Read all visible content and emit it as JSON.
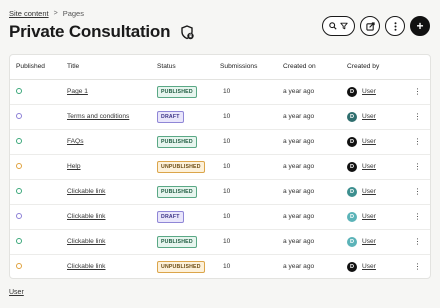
{
  "breadcrumb": {
    "parent": "Site content",
    "separator": ">",
    "current": "Pages"
  },
  "page": {
    "title": "Private Consultation",
    "title_icon": "shield-lock-icon"
  },
  "toolbar": {
    "search_icon": "search-icon",
    "filter_icon": "filter-icon",
    "edit_icon": "edit-external-icon",
    "more_icon": "more-vertical-icon",
    "add_label": "+"
  },
  "table": {
    "headers": {
      "published": "Published",
      "title": "Title",
      "status": "Status",
      "submissions": "Submissions",
      "created_on": "Created on",
      "created_by": "Created by"
    },
    "rows": [
      {
        "published_color": "#3aa77a",
        "title": "Page 1",
        "status": "PUBLISHED",
        "status_kind": "published",
        "submissions": "10",
        "created_on": "a year ago",
        "avatar": "D",
        "avatar_color": "#111111",
        "user": "User",
        "menu": "⋮"
      },
      {
        "published_color": "#8c7fd6",
        "title": "Terms and conditions",
        "status": "DRAFT",
        "status_kind": "draft",
        "submissions": "10",
        "created_on": "a year ago",
        "avatar": "D",
        "avatar_color": "#2f6e6e",
        "user": "User",
        "menu": "⋮"
      },
      {
        "published_color": "#3aa77a",
        "title": "FAQs",
        "status": "PUBLISHED",
        "status_kind": "published",
        "submissions": "10",
        "created_on": "a year ago",
        "avatar": "D",
        "avatar_color": "#111111",
        "user": "User",
        "menu": "⋮"
      },
      {
        "published_color": "#e0a23e",
        "title": "Help",
        "status": "UNPUBLISHED",
        "status_kind": "unpublished",
        "submissions": "10",
        "created_on": "a year ago",
        "avatar": "D",
        "avatar_color": "#111111",
        "user": "User",
        "menu": "⋮"
      },
      {
        "published_color": "#3aa77a",
        "title": "Clickable link",
        "status": "PUBLISHED",
        "status_kind": "published",
        "submissions": "10",
        "created_on": "a year ago",
        "avatar": "D",
        "avatar_color": "#3d8f8f",
        "user": "User",
        "menu": "⋮"
      },
      {
        "published_color": "#8c7fd6",
        "title": "Clickable link",
        "status": "DRAFT",
        "status_kind": "draft",
        "submissions": "10",
        "created_on": "a year ago",
        "avatar": "D",
        "avatar_color": "#5bb3b8",
        "user": "User",
        "menu": "⋮"
      },
      {
        "published_color": "#3aa77a",
        "title": "Clickable link",
        "status": "PUBLISHED",
        "status_kind": "published",
        "submissions": "10",
        "created_on": "a year ago",
        "avatar": "D",
        "avatar_color": "#5bb3b8",
        "user": "User",
        "menu": "⋮"
      },
      {
        "published_color": "#e0a23e",
        "title": "Clickable link",
        "status": "UNPUBLISHED",
        "status_kind": "unpublished",
        "submissions": "10",
        "created_on": "a year ago",
        "avatar": "D",
        "avatar_color": "#111111",
        "user": "User",
        "menu": "⋮"
      }
    ]
  },
  "footer": {
    "user_link": "User"
  }
}
